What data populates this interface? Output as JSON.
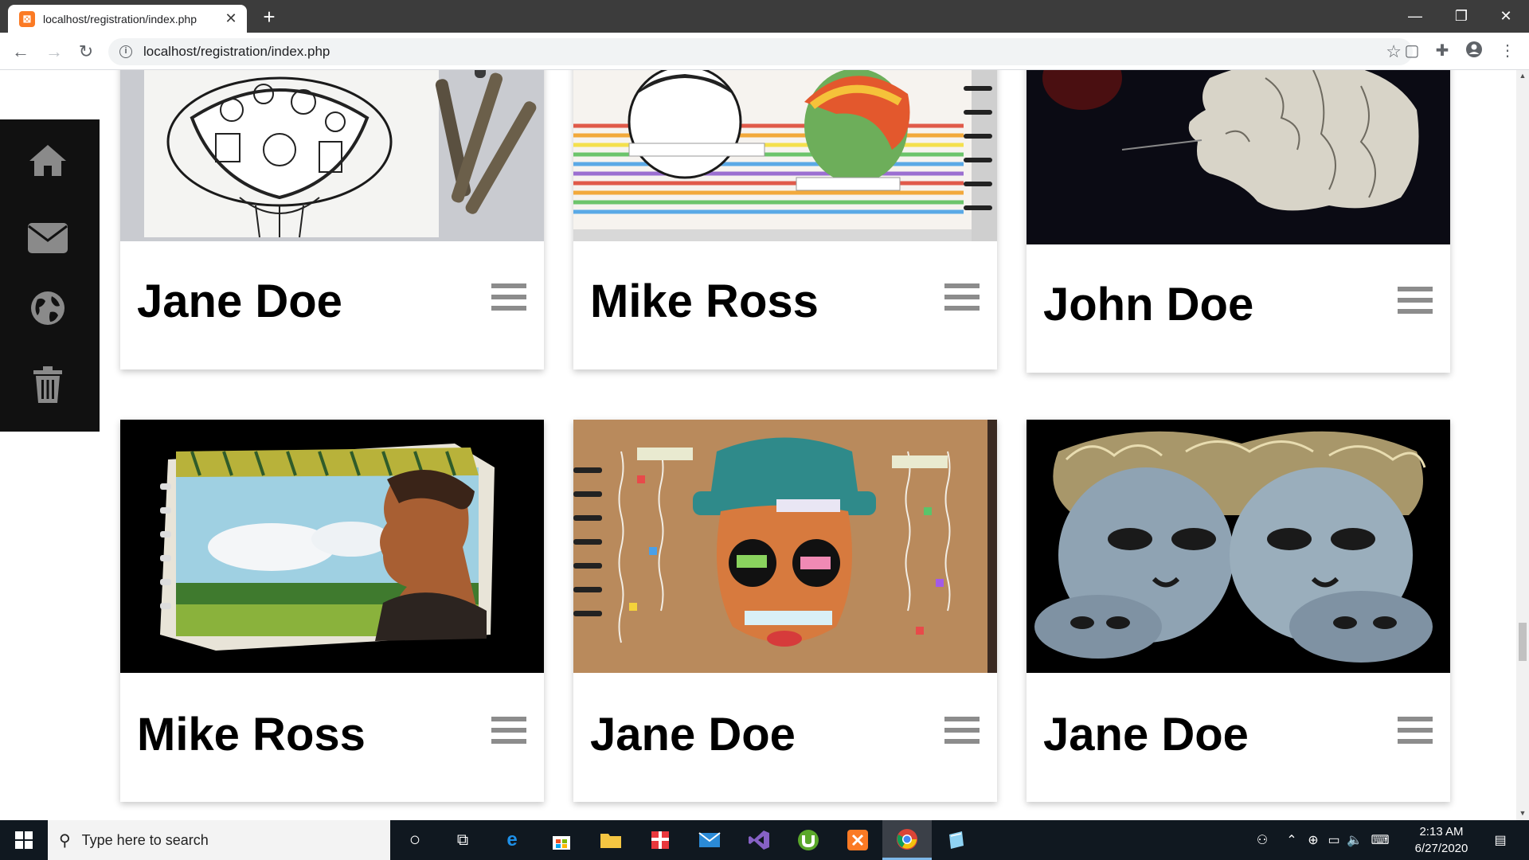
{
  "browser": {
    "tab_title": "localhost/registration/index.php",
    "tab_favicon": "xampp-icon",
    "tab_close": "✕",
    "new_tab": "+",
    "window_controls": {
      "minimize": "—",
      "maximize": "❐",
      "close": "✕"
    },
    "url": "localhost/registration/index.php"
  },
  "sidebar": {
    "items": [
      {
        "icon": "home-icon"
      },
      {
        "icon": "envelope-icon"
      },
      {
        "icon": "globe-icon"
      },
      {
        "icon": "trash-icon"
      }
    ]
  },
  "cards": [
    {
      "name": "Jane Doe",
      "image": "pen-drawing-artwork"
    },
    {
      "name": "Mike Ross",
      "image": "journal-two-faces-artwork"
    },
    {
      "name": "John Doe",
      "image": "dark-profile-sketch-artwork"
    },
    {
      "name": "Mike Ross",
      "image": "painted-boy-landscape-artwork"
    },
    {
      "name": "Jane Doe",
      "image": "journal-face-collage-artwork"
    },
    {
      "name": "Jane Doe",
      "image": "metallic-faces-artwork"
    }
  ],
  "taskbar": {
    "search_placeholder": "Type here to search",
    "time": "2:13 AM",
    "date": "6/27/2020"
  },
  "colors": {
    "sidebar_bg": "#111111",
    "titlebar_bg": "#3c3c3c",
    "taskbar_bg": "#101820",
    "menu_bars": "#8c8c8c"
  }
}
